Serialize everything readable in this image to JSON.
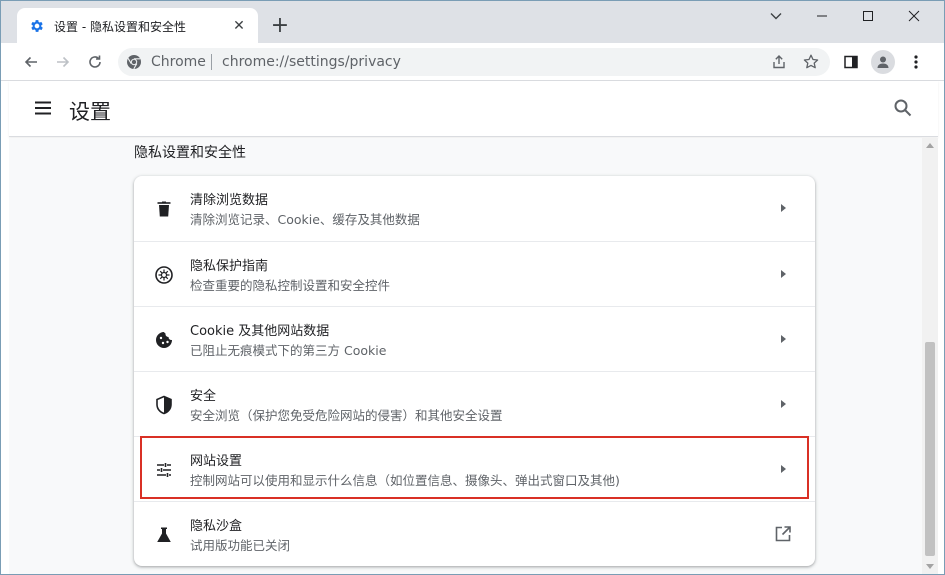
{
  "tab": {
    "title": "设置 - 隐私设置和安全性",
    "close_glyph": "✕"
  },
  "newtab_glyph": "+",
  "window_controls": {
    "menu": "⌄",
    "minimize": "—",
    "maximize": "☐",
    "close": "✕"
  },
  "omnibox": {
    "chip": "Chrome",
    "url": "chrome://settings/privacy"
  },
  "header": {
    "title": "设置"
  },
  "section": {
    "title": "隐私设置和安全性"
  },
  "rows": [
    {
      "icon": "trash-icon",
      "title": "清除浏览数据",
      "subtitle": "清除浏览记录、Cookie、缓存及其他数据",
      "action": "arrow"
    },
    {
      "icon": "compass-icon",
      "title": "隐私保护指南",
      "subtitle": "检查重要的隐私控制设置和安全控件",
      "action": "arrow"
    },
    {
      "icon": "cookie-icon",
      "title": "Cookie 及其他网站数据",
      "subtitle": "已阻止无痕模式下的第三方 Cookie",
      "action": "arrow"
    },
    {
      "icon": "shield-icon",
      "title": "安全",
      "subtitle": "安全浏览（保护您免受危险网站的侵害）和其他安全设置",
      "action": "arrow"
    },
    {
      "icon": "sliders-icon",
      "title": "网站设置",
      "subtitle": "控制网站可以使用和显示什么信息（如位置信息、摄像头、弹出式窗口及其他)",
      "action": "arrow"
    },
    {
      "icon": "flask-icon",
      "title": "隐私沙盒",
      "subtitle": "试用版功能已关闭",
      "action": "external"
    }
  ],
  "colors": {
    "accent": "#1a73e8",
    "highlight": "#d93025",
    "icon": "#5f6368"
  }
}
